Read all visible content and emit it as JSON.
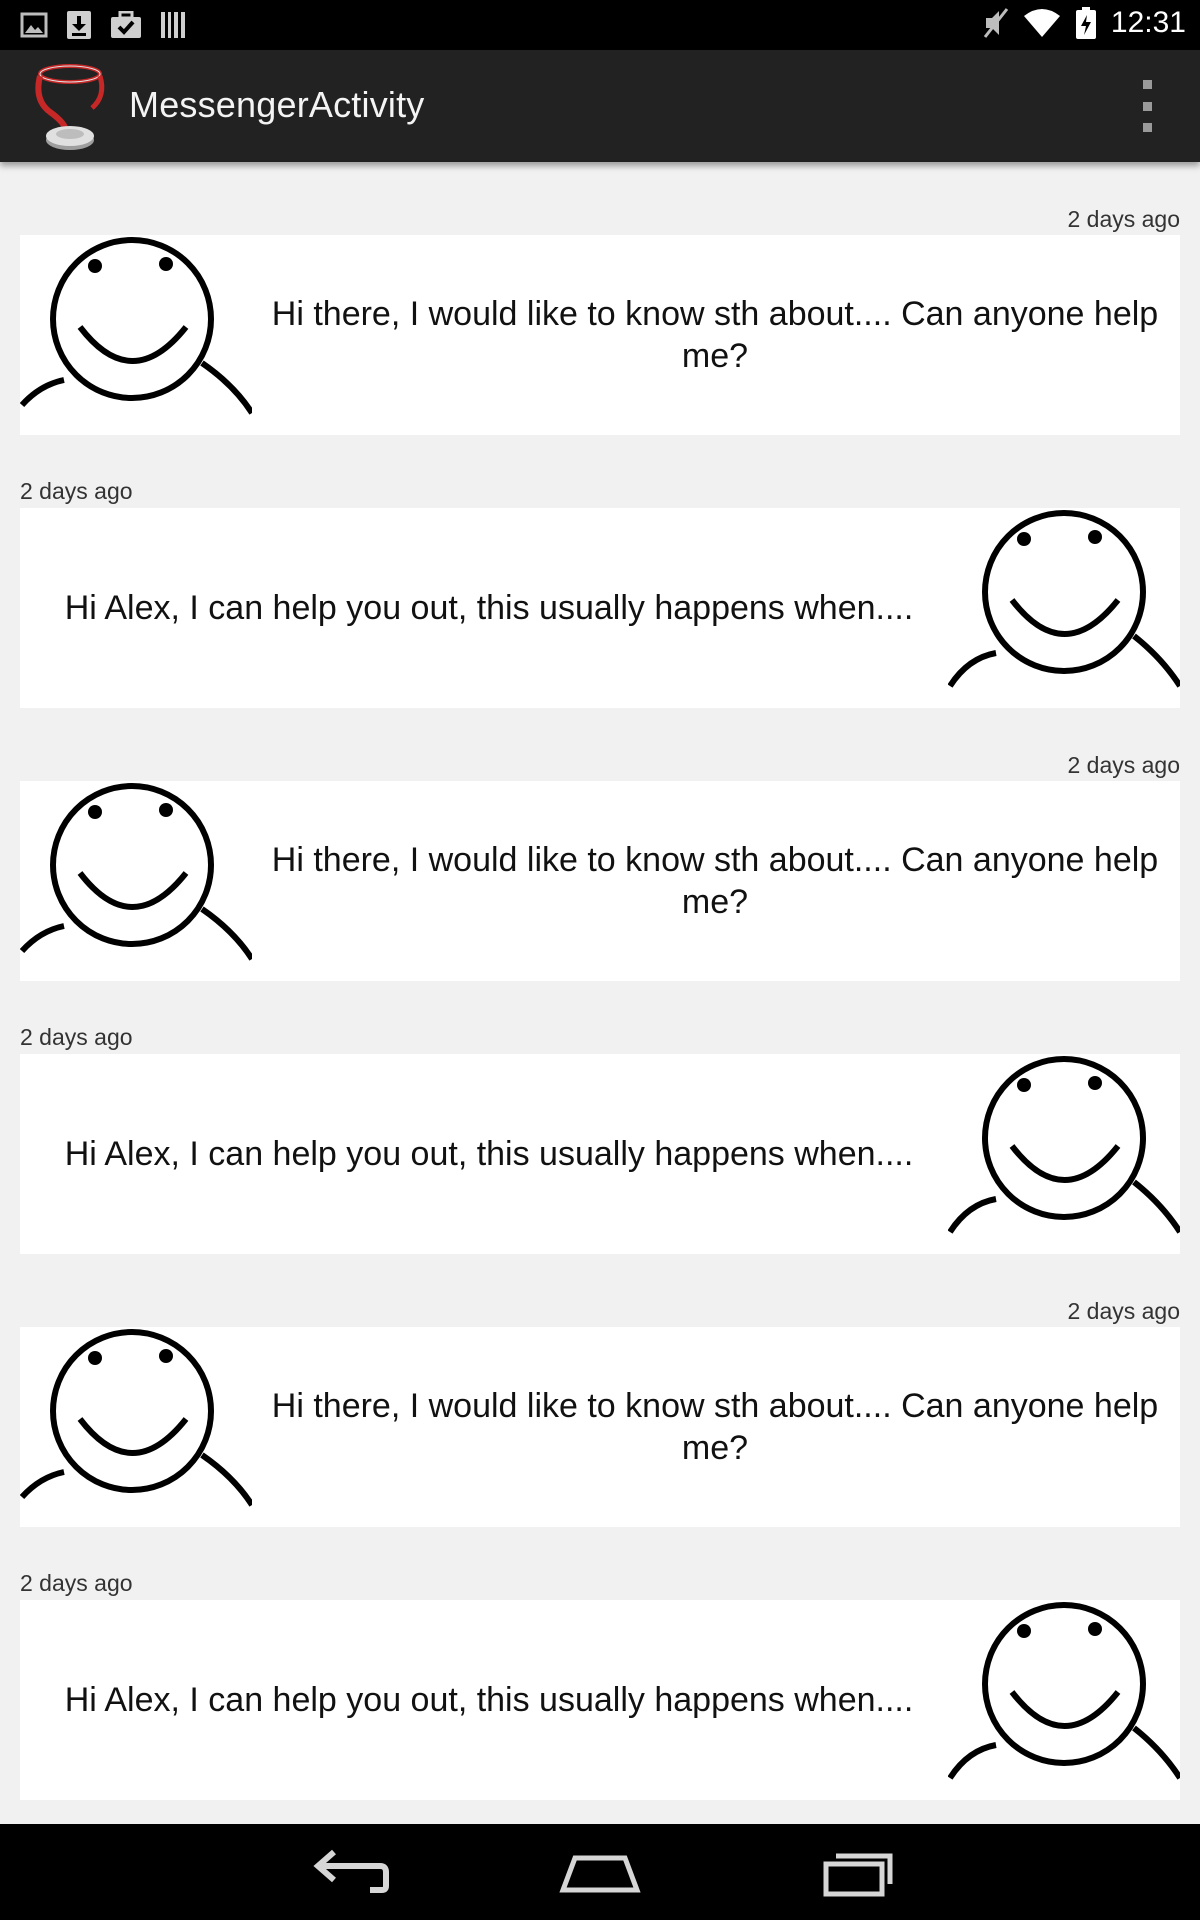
{
  "status_bar": {
    "time": "12:31",
    "left_icons": [
      "gallery-icon",
      "download-icon",
      "task-done-icon",
      "barcode-icon"
    ],
    "right_icons": [
      "mute-icon",
      "wifi-icon",
      "battery-icon"
    ]
  },
  "action_bar": {
    "title": "MessengerActivity",
    "icon": "stethoscope-app-icon",
    "menu_icon": "overflow-menu-icon"
  },
  "messages": [
    {
      "direction": "incoming",
      "time": "2 days ago",
      "text": "Hi there, I would like to know sth about.... Can anyone help me?",
      "avatar": "smiley-avatar-icon"
    },
    {
      "direction": "outgoing",
      "time": "2 days ago",
      "text": "Hi Alex, I can help you out, this usually happens when....",
      "avatar": "smiley-avatar-icon"
    },
    {
      "direction": "incoming",
      "time": "2 days ago",
      "text": "Hi there, I would like to know sth about.... Can anyone help me?",
      "avatar": "smiley-avatar-icon"
    },
    {
      "direction": "outgoing",
      "time": "2 days ago",
      "text": "Hi Alex, I can help you out, this usually happens when....",
      "avatar": "smiley-avatar-icon"
    },
    {
      "direction": "incoming",
      "time": "2 days ago",
      "text": "Hi there, I would like to know sth about.... Can anyone help me?",
      "avatar": "smiley-avatar-icon"
    },
    {
      "direction": "outgoing",
      "time": "2 days ago",
      "text": "Hi Alex, I can help you out, this usually happens when....",
      "avatar": "smiley-avatar-icon"
    }
  ],
  "nav_bar": {
    "buttons": [
      "back-icon",
      "home-icon",
      "recent-apps-icon"
    ]
  },
  "colors": {
    "status_bar_bg": "#000000",
    "action_bar_bg": "#222222",
    "feed_bg": "#f1f1f1",
    "bubble_bg": "#ffffff",
    "text": "#111111",
    "timestamp": "#333333"
  }
}
